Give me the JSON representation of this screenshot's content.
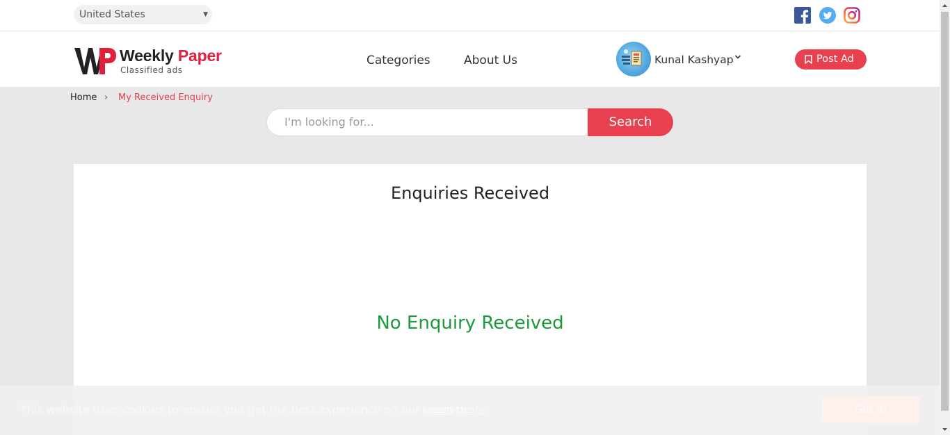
{
  "topbar": {
    "country": "United States",
    "social": [
      "facebook-icon",
      "twitter-icon",
      "instagram-icon"
    ]
  },
  "logo": {
    "title_part1": "Weekly",
    "title_part2": "Paper",
    "subtitle": "Classified ads"
  },
  "nav": {
    "categories": "Categories",
    "about": "About Us"
  },
  "user": {
    "name": "Kunal Kashyap"
  },
  "post_ad": {
    "label": "Post Ad"
  },
  "breadcrumb": {
    "home": "Home",
    "separator": "›",
    "current": "My Received Enquiry"
  },
  "search": {
    "placeholder": "I'm looking for...",
    "button": "Search"
  },
  "card": {
    "title": "Enquiries Received",
    "empty_message": "No Enquiry Received"
  },
  "cookie": {
    "text": "This website uses cookies to ensure you get the best experience on our website.",
    "link": "Learn more",
    "button": "Got it!"
  },
  "colors": {
    "accent": "#e8404e",
    "success": "#1a9a3a",
    "background": "#e8e8e8"
  }
}
